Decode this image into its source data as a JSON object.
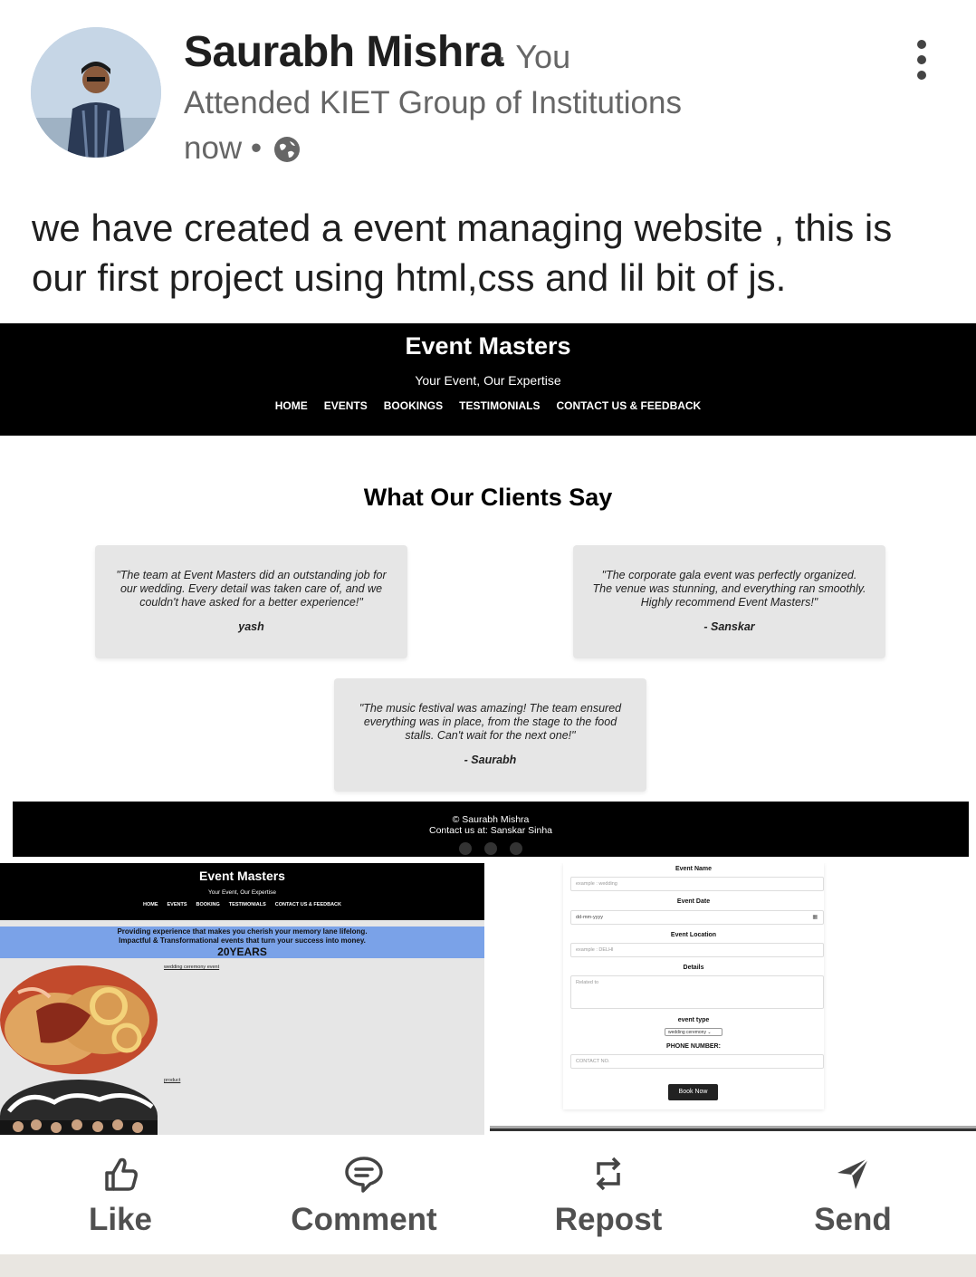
{
  "post": {
    "author": "Saurabh Mishra",
    "badge": "· You",
    "headline": "Attended KIET Group of Institutions",
    "time": "now •",
    "text": "we have created a event managing website , this is our first project using html,css and lil bit of js."
  },
  "site": {
    "title": "Event Masters",
    "tagline": "Your Event, Our Expertise",
    "nav": [
      "HOME",
      "EVENTS",
      "BOOKINGS",
      "TESTIMONIALS",
      "CONTACT US & FEEDBACK"
    ],
    "testimonials_heading": "What Our Clients Say",
    "testimonials": [
      {
        "quote": "\"The team at Event Masters did an outstanding job for our wedding. Every detail was taken care of, and we couldn't have asked for a better experience!\"",
        "author": "yash"
      },
      {
        "quote": "\"The corporate gala event was perfectly organized. The venue was stunning, and everything ran smoothly. Highly recommend Event Masters!\"",
        "author": "- Sanskar"
      },
      {
        "quote": "\"The music festival was amazing! The team ensured everything was in place, from the stage to the food stalls. Can't wait for the next one!\"",
        "author": "- Saurabh"
      }
    ],
    "footer_line1": "© Saurabh Mishra",
    "footer_line2": "Contact us at: Sanskar Sinha"
  },
  "site2": {
    "title": "Event Masters",
    "tagline": "Your Event, Our Expertise",
    "nav": [
      "HOME",
      "EVENTS",
      "BOOKING",
      "TESTIMONIALS",
      "CONTACT US & FEEDBACK"
    ],
    "banner_line1": "Providing experience that makes you cherish your memory lane lifelong.",
    "banner_line2": "Impactful & Transformational events that turn your success into money.",
    "banner_line3": "20YEARS",
    "link1": "wedding ceremony event",
    "link2": "product"
  },
  "form": {
    "event_name_label": "Event Name",
    "event_name_placeholder": "example : wedding",
    "event_date_label": "Event Date",
    "event_date_placeholder": "dd-mm-yyyy",
    "event_location_label": "Event Location",
    "event_location_placeholder": "example : DELHI",
    "details_label": "Details",
    "details_placeholder": "Related to",
    "event_type_label": "event type",
    "event_type_value": "wedding ceremony",
    "phone_label": "PHONE NUMBER:",
    "phone_placeholder": "CONTACT NO.",
    "book_button": "Book Now"
  },
  "actions": {
    "like": "Like",
    "comment": "Comment",
    "repost": "Repost",
    "send": "Send"
  },
  "icons": [
    "globe-icon",
    "more-icon",
    "like-icon",
    "comment-icon",
    "repost-icon",
    "send-icon",
    "calendar-icon"
  ]
}
